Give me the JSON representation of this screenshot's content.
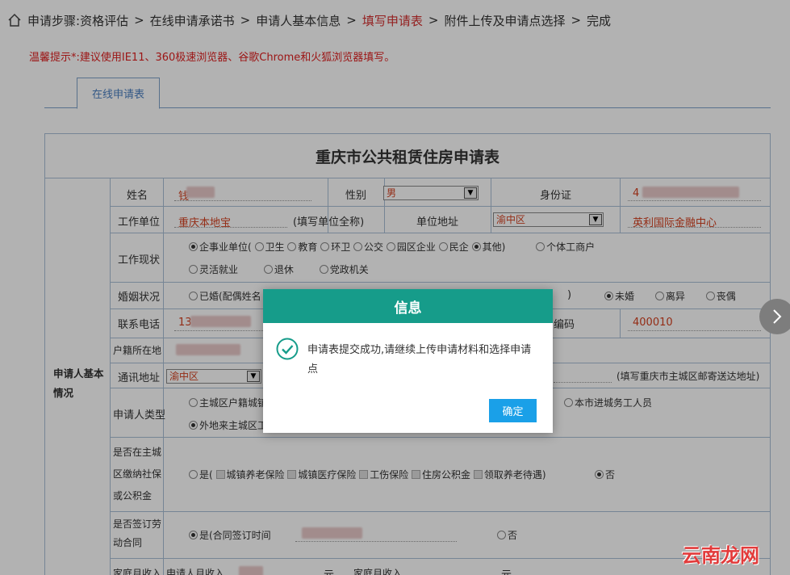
{
  "breadcrumb": {
    "prefix": "申请步骤:",
    "steps": [
      "资格评估",
      "在线申请承诺书",
      "申请人基本信息",
      "填写申请表",
      "附件上传及申请点选择",
      "完成"
    ],
    "separator": ">",
    "active_index": 3
  },
  "tip": "温馨提示*:建议使用IE11、360极速浏览器、谷歌Chrome和火狐浏览器填写。",
  "tab": {
    "label": "在线申请表"
  },
  "form": {
    "title": "重庆市公共租赁住房申请表",
    "section_label": "申请人基本情况",
    "name_label": "姓名",
    "name_value": "钱",
    "gender_label": "性别",
    "gender_value": "男",
    "id_label": "身份证",
    "id_value": "4",
    "employer_label": "工作单位",
    "employer_value": "重庆本地宝",
    "employer_hint": "(填写单位全称)",
    "address_label": "单位地址",
    "address_district": "渝中区",
    "address_value": "英利国际金融中心",
    "work_status_label": "工作现状",
    "work_options_row1": [
      "企事业单位(",
      "卫生",
      "教育",
      "环卫",
      "公交",
      "园区企业",
      "民企",
      "其他)",
      "个体工商户"
    ],
    "work_options_row2": [
      "灵活就业",
      "退休",
      "党政机关"
    ],
    "marital_label": "婚姻状况",
    "married_option": "已婚(配偶姓名",
    "marital_close": ")",
    "marital_options": [
      "未婚",
      "离异",
      "丧偶"
    ],
    "phone_label": "联系电话",
    "phone_value": "13",
    "postcode_label": "编码",
    "postcode_value": "400010",
    "hukou_label": "户籍所在地",
    "mail_label": "通讯地址",
    "mail_district": "渝中区",
    "mail_hint": "(填写重庆市主城区邮寄送达地址)",
    "applicant_type_label": "申请人类型",
    "applicant_type_row1": [
      "主城区户籍城镇",
      "本市进城务工人员"
    ],
    "applicant_type_row2": "外地来主城区工",
    "social_label_lines": [
      "是否在主城",
      "区缴纳社保",
      "或公积金"
    ],
    "social_yes": "是(",
    "social_items": [
      "城镇养老保险",
      "城镇医疗保险",
      "工伤保险",
      "住房公积金",
      "领取养老待遇)"
    ],
    "social_no": "否",
    "contract_label_lines": [
      "是否签订劳",
      "动合同"
    ],
    "contract_yes": "是(合同签订时间",
    "contract_no": "否",
    "income_label": "家庭月收入",
    "income_applicant": "申请人月收入",
    "income_unit": "元",
    "income_family": "家庭月收入",
    "income_unit2": "元"
  },
  "dialog": {
    "title": "信息",
    "message": "申请表提交成功,请继续上传申请材料和选择申请点",
    "confirm": "确定"
  },
  "watermark": "云南龙网"
}
